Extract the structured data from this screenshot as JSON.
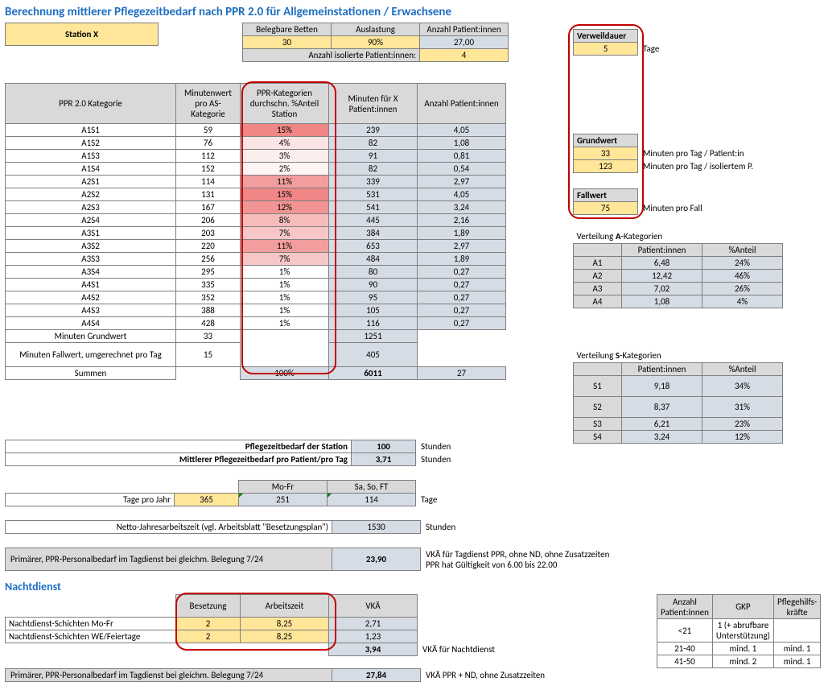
{
  "title": "Berechnung mittlerer Pflegezeitbedarf nach PPR 2.0 für Allgemeinstationen / Erwachsene",
  "station": "Station X",
  "top": {
    "h1": "Belegbare Betten",
    "h2": "Auslastung",
    "h3": "Anzahl Patient:innen",
    "v1": "30",
    "v2": "90%",
    "v3": "27,00",
    "isoLabel": "Anzahl isolierte Patient:innen:",
    "iso": "4"
  },
  "verw": {
    "label": "Verweildauer",
    "val": "5",
    "unit": "Tage"
  },
  "grund": {
    "label": "Grundwert",
    "v1": "33",
    "u1": "Minuten pro Tag / Patient:in",
    "v2": "123",
    "u2": "Minuten pro Tag / isoliertem P."
  },
  "fall": {
    "label": "Fallwert",
    "val": "75",
    "unit": "Minuten pro Fall"
  },
  "mainH": {
    "c1": "PPR 2.0 Kategorie",
    "c2": "Minutenwert pro AS-Kategorie",
    "c3": "PPR-Kategorien durchschn. %Anteil Station",
    "c4": "Minuten für X Patient:innen",
    "c5": "Anzahl Patient:innen"
  },
  "rows": [
    {
      "k": "A1S1",
      "m": "59",
      "p": "15%",
      "x": "239",
      "n": "4,05",
      "bg": "#f08686"
    },
    {
      "k": "A1S2",
      "m": "76",
      "p": "4%",
      "x": "82",
      "n": "1,08",
      "bg": "#fbe4e4"
    },
    {
      "k": "A1S3",
      "m": "112",
      "p": "3%",
      "x": "91",
      "n": "0,81",
      "bg": "#fdeeee"
    },
    {
      "k": "A1S4",
      "m": "152",
      "p": "2%",
      "x": "82",
      "n": "0,54",
      "bg": "#fff5f5"
    },
    {
      "k": "A2S1",
      "m": "114",
      "p": "11%",
      "x": "339",
      "n": "2,97",
      "bg": "#f29e9e"
    },
    {
      "k": "A2S2",
      "m": "131",
      "p": "15%",
      "x": "531",
      "n": "4,05",
      "bg": "#f08686"
    },
    {
      "k": "A2S3",
      "m": "167",
      "p": "12%",
      "x": "541",
      "n": "3,24",
      "bg": "#f19494"
    },
    {
      "k": "A2S4",
      "m": "206",
      "p": "8%",
      "x": "445",
      "n": "2,16",
      "bg": "#f6bcbc"
    },
    {
      "k": "A3S1",
      "m": "203",
      "p": "7%",
      "x": "384",
      "n": "1,89",
      "bg": "#f7c6c6"
    },
    {
      "k": "A3S2",
      "m": "220",
      "p": "11%",
      "x": "653",
      "n": "2,97",
      "bg": "#f29e9e"
    },
    {
      "k": "A3S3",
      "m": "256",
      "p": "7%",
      "x": "484",
      "n": "1,89",
      "bg": "#f7c6c6"
    },
    {
      "k": "A3S4",
      "m": "295",
      "p": "1%",
      "x": "80",
      "n": "0,27",
      "bg": "#ffffff"
    },
    {
      "k": "A4S1",
      "m": "335",
      "p": "1%",
      "x": "90",
      "n": "0,27",
      "bg": "#ffffff"
    },
    {
      "k": "A4S2",
      "m": "352",
      "p": "1%",
      "x": "95",
      "n": "0,27",
      "bg": "#ffffff"
    },
    {
      "k": "A4S3",
      "m": "388",
      "p": "1%",
      "x": "105",
      "n": "0,27",
      "bg": "#ffffff"
    },
    {
      "k": "A4S4",
      "m": "428",
      "p": "1%",
      "x": "116",
      "n": "0,27",
      "bg": "#ffffff"
    }
  ],
  "gw": {
    "k": "Minuten Grundwert",
    "m": "33",
    "x": "1251"
  },
  "fw": {
    "k": "Minuten Fallwert, umgerechnet pro Tag",
    "m": "15",
    "x": "405"
  },
  "sum": {
    "k": "Summen",
    "p": "100%",
    "x": "6011",
    "n": "27"
  },
  "res": {
    "r1l": "Pflegezeitbedarf der Station",
    "r1v": "100",
    "r1u": "Stunden",
    "r2l": "Mittlerer Pflegezeitbedarf pro Patient/pro Tag",
    "r2v": "3,71",
    "r2u": "Stunden"
  },
  "days": {
    "h1": "Mo-Fr",
    "h2": "Sa, So, FT",
    "label": "Tage pro Jahr",
    "tot": "365",
    "mf": "251",
    "we": "114",
    "unit": "Tage"
  },
  "netto": {
    "label": "Netto-Jahresarbeitszeit (vgl. Arbeitsblatt \"Besetzungsplan\")",
    "val": "1530",
    "unit": "Stunden"
  },
  "prim1": {
    "label": "Primärer, PPR-Personalbedarf im Tagdienst bei gleichm. Belegung 7/24",
    "val": "23,90",
    "t1": "VKÄ für Tagdienst PPR, ohne ND, ohne Zusatzzeiten",
    "t2": "PPR hat Gültigkeit von 6.00 bis 22.00"
  },
  "nacht": {
    "title": "Nachtdienst",
    "h1": "Besetzung",
    "h2": "Arbeitszeit",
    "h3": "VKÄ",
    "r1": "Nachtdienst-Schichten Mo-Fr",
    "r1b": "2",
    "r1a": "8,25",
    "r1v": "2,71",
    "r2": "Nachtdienst-Schichten WE/Feiertage",
    "r2b": "2",
    "r2a": "8,25",
    "r2v": "1,23",
    "sum": "3,94",
    "sumu": "VKÄ für Nachtdienst"
  },
  "prim2": {
    "label": "Primärer, PPR-Personalbedarf im Tagdienst bei gleichm. Belegung 7/24",
    "val": "27,84",
    "unit": "VKÄ PPR + ND, ohne Zusatzzeiten"
  },
  "distA": {
    "title": "Verteilung A-Kategorien",
    "h1": "Patient:innen",
    "h2": "%Anteil",
    "rows": [
      [
        "A1",
        "6,48",
        "24%"
      ],
      [
        "A2",
        "12,42",
        "46%"
      ],
      [
        "A3",
        "7,02",
        "26%"
      ],
      [
        "A4",
        "1,08",
        "4%"
      ]
    ]
  },
  "distS": {
    "title": "Verteilung S-Kategorien",
    "h1": "Patient:innen",
    "h2": "%Anteil",
    "rows": [
      [
        "S1",
        "9,18",
        "34%"
      ],
      [
        "S2",
        "8,37",
        "31%"
      ],
      [
        "S3",
        "6,21",
        "23%"
      ],
      [
        "S4",
        "3,24",
        "12%"
      ]
    ]
  },
  "staff": {
    "h1": "Anzahl Patient:innen",
    "h2": "GKP",
    "h3": "Pflegehilfs-kräfte",
    "rows": [
      [
        "<21",
        "1 (+ abrufbare Unterstützung)",
        ""
      ],
      [
        "21-40",
        "mind. 1",
        "mind. 1"
      ],
      [
        "41-50",
        "mind. 2",
        "mind. 1"
      ]
    ]
  }
}
